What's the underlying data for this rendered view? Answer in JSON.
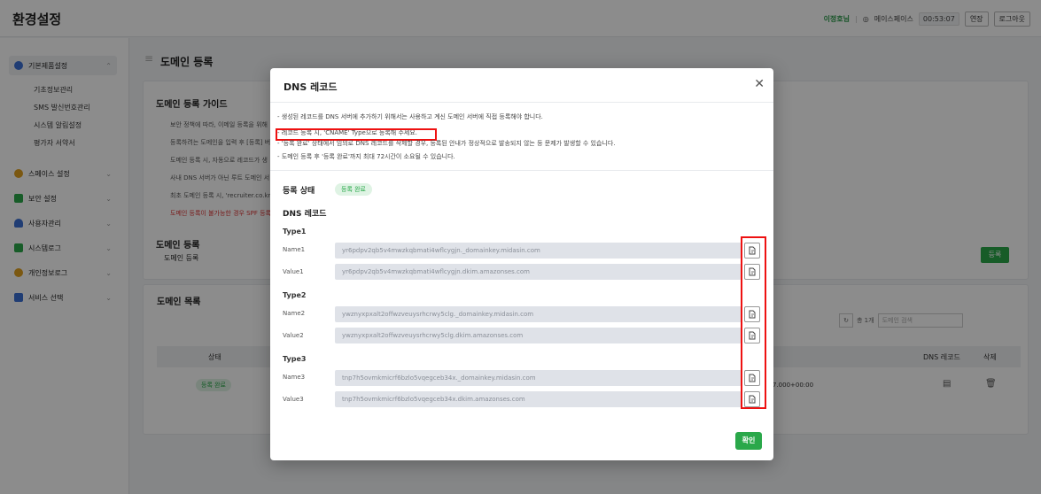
{
  "header": {
    "title": "환경설정",
    "user": "이정호님",
    "workspace": "메이스페이스",
    "timer": "00:53:07",
    "extend": "연장",
    "logout": "로그아웃"
  },
  "sidebar": {
    "groups": [
      {
        "label": "기본제품설정",
        "color": "#3b6fd4"
      },
      {
        "label": "스페이스 설정",
        "color": "#e0a020"
      },
      {
        "label": "보안 설정",
        "color": "#2aa84a"
      },
      {
        "label": "사용자관리",
        "color": "#3b6fd4"
      },
      {
        "label": "시스템로그",
        "color": "#2aa84a"
      },
      {
        "label": "개인정보로그",
        "color": "#e0a020"
      },
      {
        "label": "서비스 선택",
        "color": "#3b6fd4"
      }
    ],
    "sub_items": [
      "기초정보관리",
      "SMS 발신번호관리",
      "시스템 알림설정",
      "평가자 서약서"
    ]
  },
  "main": {
    "page_title": "도메인 등록",
    "guide_title": "도메인 등록 가이드",
    "guide_lines": [
      "보안 정책에 따라, 이메일 등록을 위해",
      "등록하려는 도메인을 입력 후 [등록] 버",
      "도메인 등록 시, 자동으로 레코드가 생",
      "사내 DNS 서버가 아닌 루트 도메인 서",
      "최초 도메인 등록 시, 'recruiter.co.kr",
      "도메인 등록이 불가능한 경우 SPF 등록"
    ],
    "register_title": "도메인 등록",
    "register_label": "도메인 등록",
    "register_button": "등록",
    "list_title": "도메인 목록",
    "total": "총 1개",
    "search_placeholder": "도메인 검색",
    "columns": {
      "status": "상태",
      "dns": "DNS 레코드",
      "delete": "삭제"
    },
    "row": {
      "status": "등록 완료",
      "date": "7.000+00:00"
    }
  },
  "modal": {
    "title": "DNS 레코드",
    "notices": [
      "- 생성된 레코드를 DNS 서버에 추가하기 위해서는 사용하고 계신 도메인 서버에 직접 등록해야 합니다.",
      "- 레코드 등록 시, 'CNAME' Type으로 등록해 주세요.",
      "- '등록 완료' 상태에서 임의로 DNS 레코드를 삭제할 경우, 등록된 안내가 정상적으로 발송되지 않는 등 문제가 발생할 수 있습니다.",
      "- 도메인 등록 후 '등록 완료'까지 최대 72시간이 소요될 수 있습니다."
    ],
    "status_label": "등록 상태",
    "status_value": "등록 완료",
    "dns_label": "DNS 레코드",
    "name_label": "Name",
    "value_label": "Value",
    "records": [
      {
        "type": "Type1",
        "name_label": "Name1",
        "value_label": "Value1",
        "name": "yr6pdpv2qb5v4mwzkqbmati4wflcygjn._domainkey.midasin.com",
        "value": "yr6pdpv2qb5v4mwzkqbmati4wflcygjn.dkim.amazonses.com"
      },
      {
        "type": "Type2",
        "name_label": "Name2",
        "value_label": "Value2",
        "name": "ywznyxpxalt2offwzveuysrhcrwy5clg._domainkey.midasin.com",
        "value": "ywznyxpxalt2offwzveuysrhcrwy5clg.dkim.amazonses.com"
      },
      {
        "type": "Type3",
        "name_label": "Name3",
        "value_label": "Value3",
        "name": "tnp7h5ovmkmicrf6bzlo5vqegceb34x._domainkey.midasin.com",
        "value": "tnp7h5ovmkmicrf6bzlo5vqegceb34x.dkim.amazonses.com"
      }
    ],
    "confirm": "확인"
  }
}
